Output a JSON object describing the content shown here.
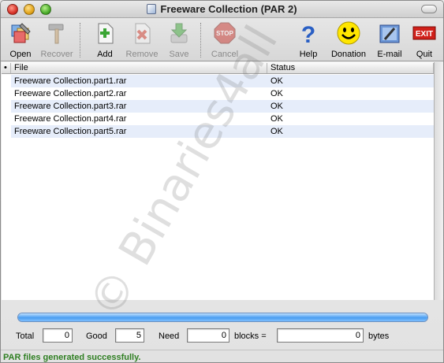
{
  "window": {
    "title": "Freeware Collection (PAR 2)"
  },
  "toolbar": {
    "open": "Open",
    "recover": "Recover",
    "add": "Add",
    "remove": "Remove",
    "save": "Save",
    "cancel": "Cancel",
    "help": "Help",
    "donation": "Donation",
    "email": "E-mail",
    "quit": "Quit",
    "exit_icon_text": "EXIT",
    "stop_icon_text": "STOP",
    "help_icon_text": "?"
  },
  "table": {
    "columns": {
      "dot": "•",
      "file": "File",
      "status": "Status"
    },
    "rows": [
      {
        "file": "Freeware Collection.part1.rar",
        "status": "OK"
      },
      {
        "file": "Freeware Collection.part2.rar",
        "status": "OK"
      },
      {
        "file": "Freeware Collection.part3.rar",
        "status": "OK"
      },
      {
        "file": "Freeware Collection.part4.rar",
        "status": "OK"
      },
      {
        "file": "Freeware Collection.part5.rar",
        "status": "OK"
      }
    ]
  },
  "watermark": "© Binaries4all",
  "progress": {
    "fraction": 1.0
  },
  "counts": {
    "total_label": "Total",
    "total_value": "0",
    "good_label": "Good",
    "good_value": "5",
    "need_label": "Need",
    "need_value": "0",
    "blocks_label": "blocks =",
    "bytes_value": "0",
    "bytes_label": "bytes"
  },
  "status": {
    "message": "PAR files generated successfully.",
    "color": "#2f7f22"
  }
}
